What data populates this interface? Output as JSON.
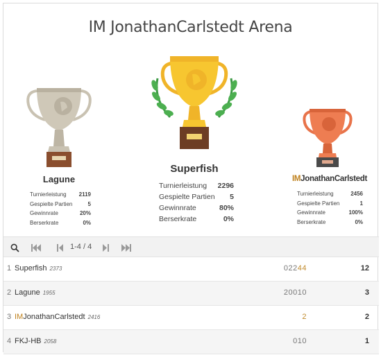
{
  "title": "IM JonathanCarlstedt Arena",
  "podium": [
    {
      "place": 2,
      "title_prefix": "",
      "name": "Lagune",
      "trophy_color": "silver",
      "stats": [
        {
          "label": "Turnierleistung",
          "value": "2119"
        },
        {
          "label": "Gespielte Partien",
          "value": "5"
        },
        {
          "label": "Gewinnrate",
          "value": "20%"
        },
        {
          "label": "Berserkrate",
          "value": "0%"
        }
      ]
    },
    {
      "place": 1,
      "title_prefix": "",
      "name": "Superfish",
      "trophy_color": "gold",
      "stats": [
        {
          "label": "Turnierleistung",
          "value": "2296"
        },
        {
          "label": "Gespielte Partien",
          "value": "5"
        },
        {
          "label": "Gewinnrate",
          "value": "80%"
        },
        {
          "label": "Berserkrate",
          "value": "0%"
        }
      ]
    },
    {
      "place": 3,
      "title_prefix": "IM",
      "name": "JonathanCarlstedt",
      "trophy_color": "bronze",
      "stats": [
        {
          "label": "Turnierleistung",
          "value": "2456"
        },
        {
          "label": "Gespielte Partien",
          "value": "1"
        },
        {
          "label": "Gewinnrate",
          "value": "100%"
        },
        {
          "label": "Berserkrate",
          "value": "0%"
        }
      ]
    }
  ],
  "toolbar": {
    "search_icon": "search-icon",
    "first_icon": "first-page-icon",
    "prev_icon": "prev-page-icon",
    "pager_text": "1-4 / 4",
    "next_icon": "next-page-icon",
    "last_icon": "last-page-icon"
  },
  "standings": [
    {
      "rank": "1",
      "title_prefix": "",
      "name": "Superfish",
      "rating": "2373",
      "sheet_plain": "022",
      "sheet_streak": "44",
      "score": "12"
    },
    {
      "rank": "2",
      "title_prefix": "",
      "name": "Lagune",
      "rating": "1955",
      "sheet_plain": "20010",
      "sheet_streak": "",
      "score": "3"
    },
    {
      "rank": "3",
      "title_prefix": "IM",
      "name": "JonathanCarlstedt",
      "rating": "2416",
      "sheet_plain": "",
      "sheet_streak": "2",
      "score": "2"
    },
    {
      "rank": "4",
      "title_prefix": "",
      "name": "FKJ-HB",
      "rating": "2058",
      "sheet_plain": "010",
      "sheet_streak": "",
      "score": "1"
    }
  ],
  "colors": {
    "gold": "#f7c630",
    "silver": "#c9c2b2",
    "bronze": "#e8734a",
    "title_accent": "#bf811d",
    "laurel": "#4caf50"
  }
}
